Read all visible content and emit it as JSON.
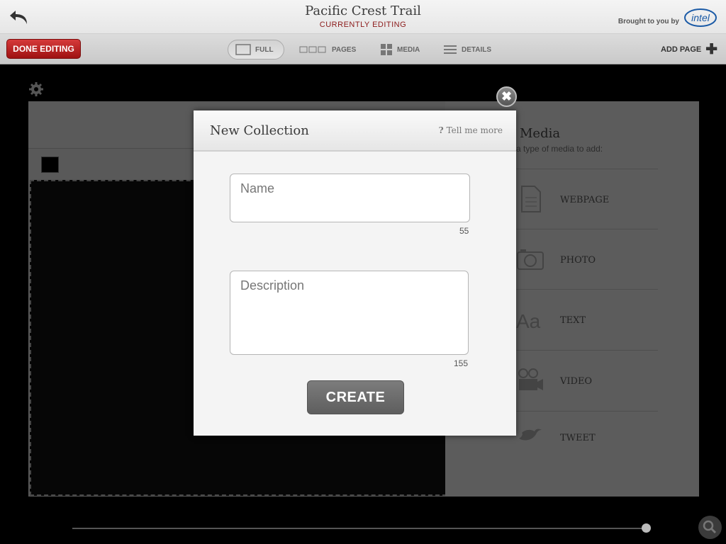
{
  "header": {
    "title": "Pacific Crest Trail",
    "subtitle": "CURRENTLY EDITING",
    "brought_by": "Brought to you by",
    "sponsor_logo_text": "intel"
  },
  "toolbar": {
    "done_label": "DONE EDITING",
    "views": [
      {
        "label": "FULL",
        "icon": "full-view-icon",
        "selected": true
      },
      {
        "label": "PAGES",
        "icon": "pages-view-icon",
        "selected": false
      },
      {
        "label": "MEDIA",
        "icon": "media-view-icon",
        "selected": false
      },
      {
        "label": "DETAILS",
        "icon": "details-view-icon",
        "selected": false
      }
    ],
    "add_page_label": "ADD PAGE"
  },
  "media_panel": {
    "title": "Media",
    "subtitle": "a type of media to add:",
    "items": [
      {
        "label": "WEBPAGE",
        "icon": "webpage-icon"
      },
      {
        "label": "PHOTO",
        "icon": "camera-icon"
      },
      {
        "label": "TEXT",
        "icon": "text-icon"
      },
      {
        "label": "VIDEO",
        "icon": "video-camera-icon"
      },
      {
        "label": "TWEET",
        "icon": "twitter-bird-icon"
      }
    ]
  },
  "modal": {
    "title": "New Collection",
    "help_label": "Tell me more",
    "help_glyph": "?",
    "name": {
      "value": "",
      "placeholder": "Name",
      "counter": "55"
    },
    "description": {
      "value": "",
      "placeholder": "Description",
      "counter": "155"
    },
    "create_label": "CREATE",
    "close_glyph": "✖"
  },
  "slider": {
    "value": 1.0
  },
  "colors": {
    "accent_red": "#b21f1f",
    "subtitle_red": "#8b1a1a",
    "create_button": "#6e6e6e",
    "modal_bg": "#f4f4f4"
  }
}
